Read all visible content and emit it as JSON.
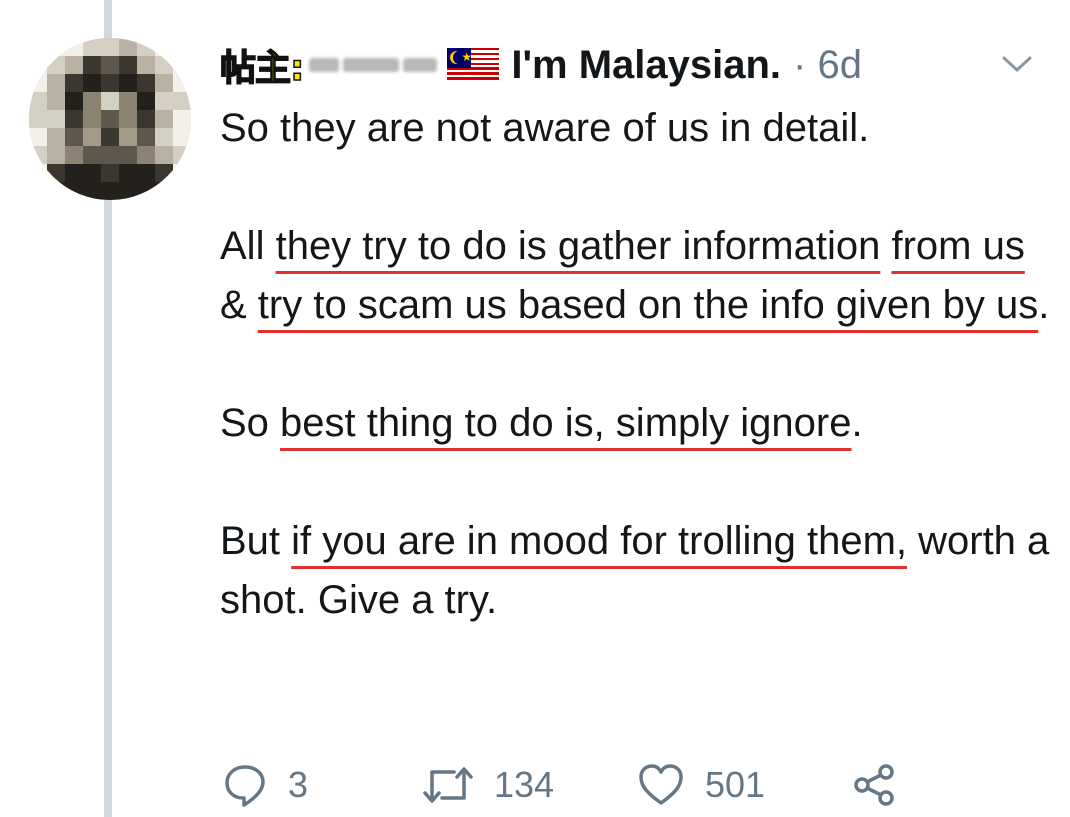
{
  "tweet": {
    "op_tag": "帖主:",
    "flag": "malaysia-flag-icon",
    "display_name": "I'm Malaysian.",
    "separator_time": "· 6d",
    "paragraphs": [
      [
        {
          "text": "So they are not aware of us in detail.",
          "underline": false
        }
      ],
      [
        {
          "text": "All ",
          "underline": false
        },
        {
          "text": "they try to do is gather information",
          "underline": true
        },
        {
          "text": " ",
          "underline": false
        },
        {
          "text": "from us",
          "underline": true
        },
        {
          "text": " & ",
          "underline": false
        },
        {
          "text": "try to scam us based on the info given by us",
          "underline": true
        },
        {
          "text": ".",
          "underline": false
        }
      ],
      [
        {
          "text": "So ",
          "underline": false
        },
        {
          "text": "best thing to do is, simply ignore",
          "underline": true
        },
        {
          "text": ".",
          "underline": false
        }
      ],
      [
        {
          "text": "But ",
          "underline": false
        },
        {
          "text": "if you are in mood for trolling them,",
          "underline": true
        },
        {
          "text": " worth a shot. Give a try.",
          "underline": false
        }
      ]
    ],
    "underline_color": "#e03131"
  },
  "actions": {
    "reply_count": "3",
    "retweet_count": "134",
    "like_count": "501"
  },
  "colors": {
    "icon": "#657786",
    "thread_line": "#d3d8dd",
    "op_tag_fill": "#ffe600"
  }
}
